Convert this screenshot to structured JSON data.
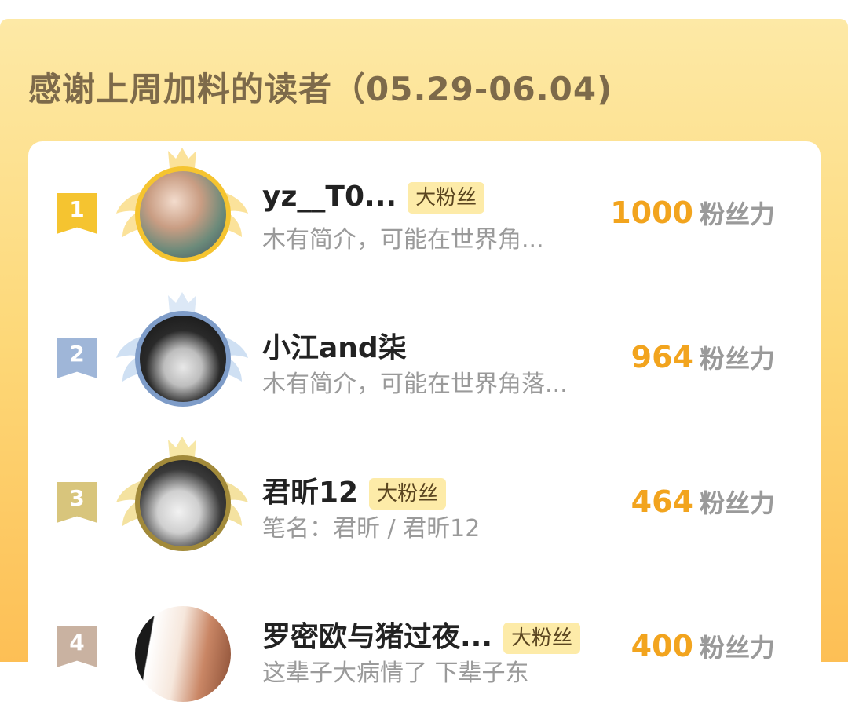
{
  "header": {
    "title": "感谢上周加料的读者（05.29-06.04)"
  },
  "colors": {
    "gold": "#f2a41e",
    "badge_bg": "#fdeba8",
    "panel_top": "#fde9a6",
    "panel_bottom": "#fdbf55"
  },
  "readers": [
    {
      "rank": "1",
      "name": "yz__T0...",
      "badge": "大粉丝",
      "bio": "木有简介，可能在世界角...",
      "points": "1000",
      "unit": "粉丝力"
    },
    {
      "rank": "2",
      "name": "小江and柒",
      "badge": "",
      "bio": "木有简介，可能在世界角落...",
      "points": "964",
      "unit": "粉丝力"
    },
    {
      "rank": "3",
      "name": "君昕12",
      "badge": "大粉丝",
      "bio": "笔名：君昕 / 君昕12",
      "points": "464",
      "unit": "粉丝力"
    },
    {
      "rank": "4",
      "name": "罗密欧与猪过夜...",
      "badge": "大粉丝",
      "bio": "这辈子大病情了 下辈子东",
      "points": "400",
      "unit": "粉丝力"
    }
  ]
}
